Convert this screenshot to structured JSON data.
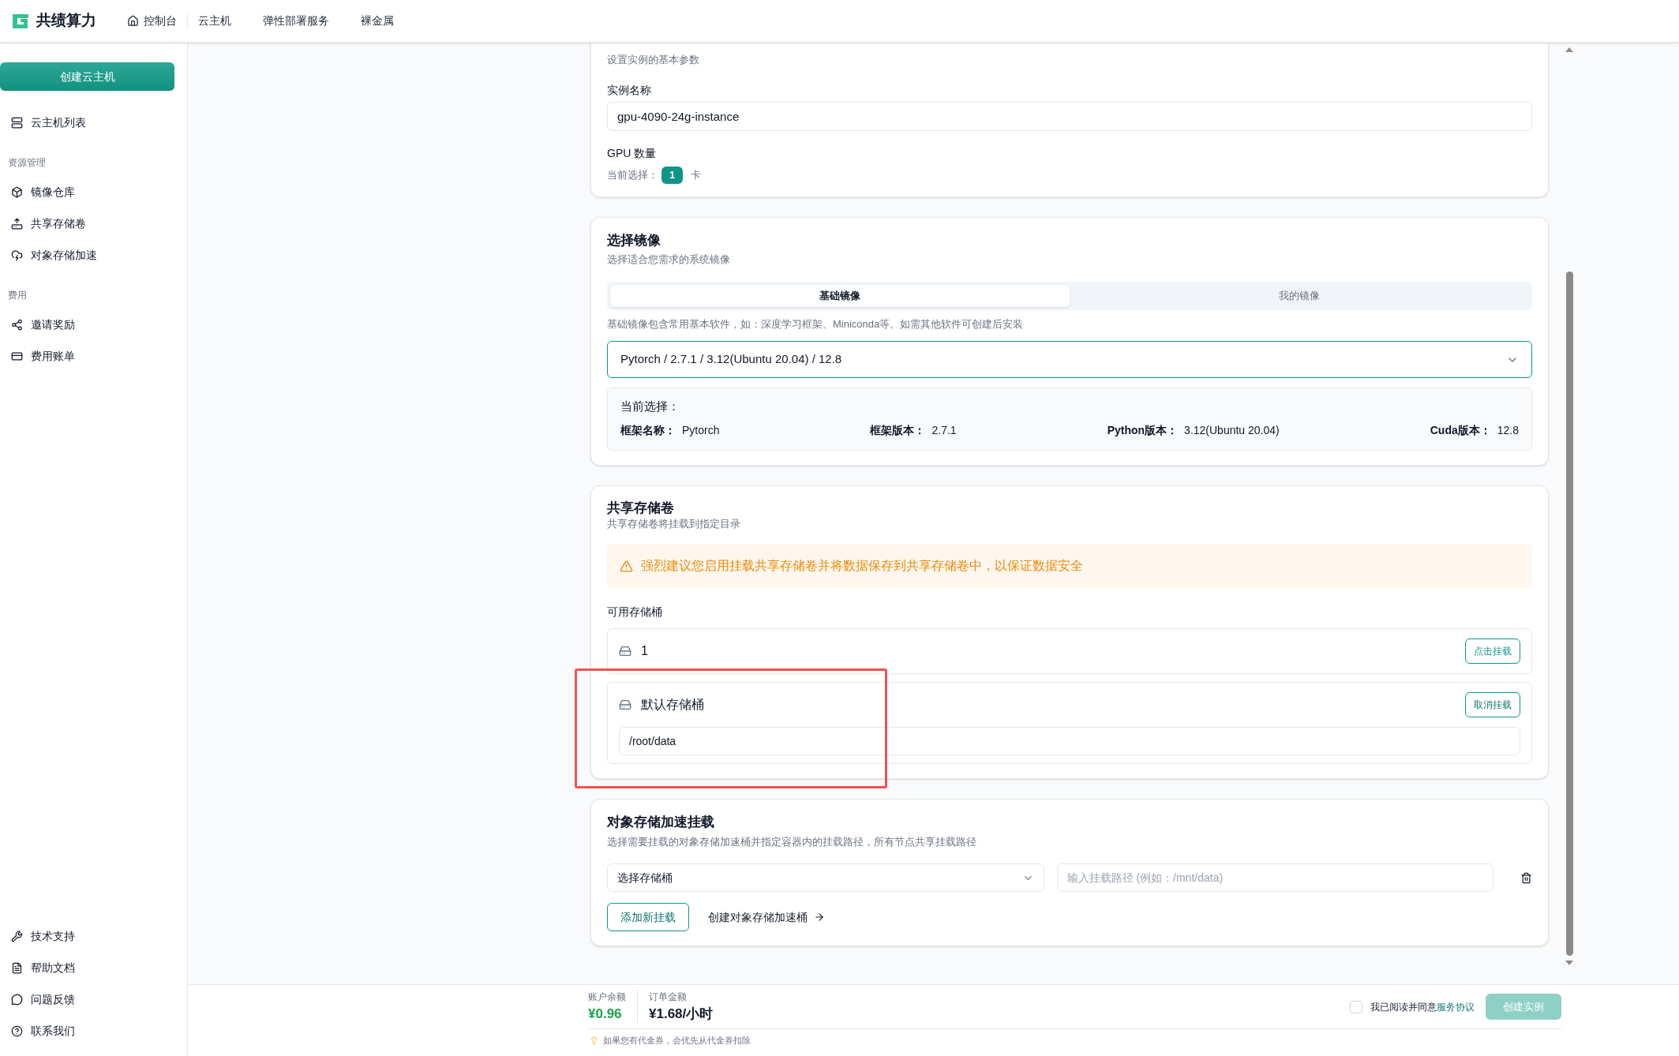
{
  "brand": {
    "name": "共绩算力"
  },
  "top_nav": [
    {
      "label": "控制台",
      "kind": "home"
    },
    {
      "label": "云主机",
      "kind": "link"
    },
    {
      "label": "弹性部署服务",
      "kind": "link"
    },
    {
      "label": "裸金属",
      "kind": "link"
    }
  ],
  "sidebar": {
    "create_button": "创建云主机",
    "groups": [
      {
        "items": [
          "云主机列表"
        ]
      },
      {
        "title": "资源管理",
        "items": [
          "镜像仓库",
          "共享存储卷",
          "对象存储加速"
        ]
      },
      {
        "title": "费用",
        "items": [
          "邀请奖励",
          "费用账单"
        ]
      }
    ],
    "bottom_items": [
      "技术支持",
      "帮助文档",
      "问题反馈",
      "联系我们"
    ]
  },
  "basic": {
    "subtitle": "设置实例的基本参数",
    "name_label": "实例名称",
    "name_value": "gpu-4090-24g-instance",
    "gpu_label": "GPU 数量",
    "gpu_prefix": "当前选择：",
    "gpu_count": "1",
    "gpu_unit": "卡"
  },
  "image": {
    "title": "选择镜像",
    "subtitle": "选择适合您需求的系统镜像",
    "tabs": [
      {
        "label": "基础镜像",
        "selected": true
      },
      {
        "label": "我的镜像",
        "selected": false
      }
    ],
    "hint": "基础镜像包含常用基本软件，如：深度学习框架、Miniconda等。如需其他软件可创建后安装",
    "select_value": "Pytorch / 2.7.1 / 3.12(Ubuntu 20.04) / 12.8",
    "current_label": "当前选择：",
    "fields": [
      {
        "label": "框架名称：",
        "value": "Pytorch"
      },
      {
        "label": "框架版本：",
        "value": "2.7.1"
      },
      {
        "label": "Python版本：",
        "value": "3.12(Ubuntu 20.04)"
      },
      {
        "label": "Cuda版本：",
        "value": "12.8"
      }
    ]
  },
  "storage": {
    "title": "共享存储卷",
    "subtitle": "共享存储卷将挂载到指定目录",
    "warning": "强烈建议您启用挂载共享存储卷并将数据保存到共享存储卷中，以保证数据安全",
    "buckets_label": "可用存储桶",
    "buckets": [
      {
        "name": "1",
        "action": "点击挂载",
        "mounted": false,
        "annotated": false
      },
      {
        "name": "默认存储桶",
        "action": "取消挂载",
        "mounted": true,
        "path": "/root/data",
        "annotated": true
      }
    ]
  },
  "object_storage": {
    "title": "对象存储加速挂载",
    "subtitle": "选择需要挂载的对象存储加速桶并指定容器内的挂载路径，所有节点共享挂载路径",
    "bucket_select": "选择存储桶",
    "path_placeholder": "输入挂载路径 (例如：/mnt/data)",
    "add_button": "添加新挂载",
    "create_link": "创建对象存储加速桶"
  },
  "footer": {
    "balance_label": "账户余额",
    "balance": "¥0.96",
    "order_label": "订单金额",
    "order_amount": "¥1.68/小时",
    "tip": "如果您有代金券，会优先从代金券扣除",
    "agree_checked": false,
    "agree_text": "我已阅读并同意",
    "agree_link": "服务协议",
    "submit": "创建实例",
    "submit_disabled": true
  }
}
